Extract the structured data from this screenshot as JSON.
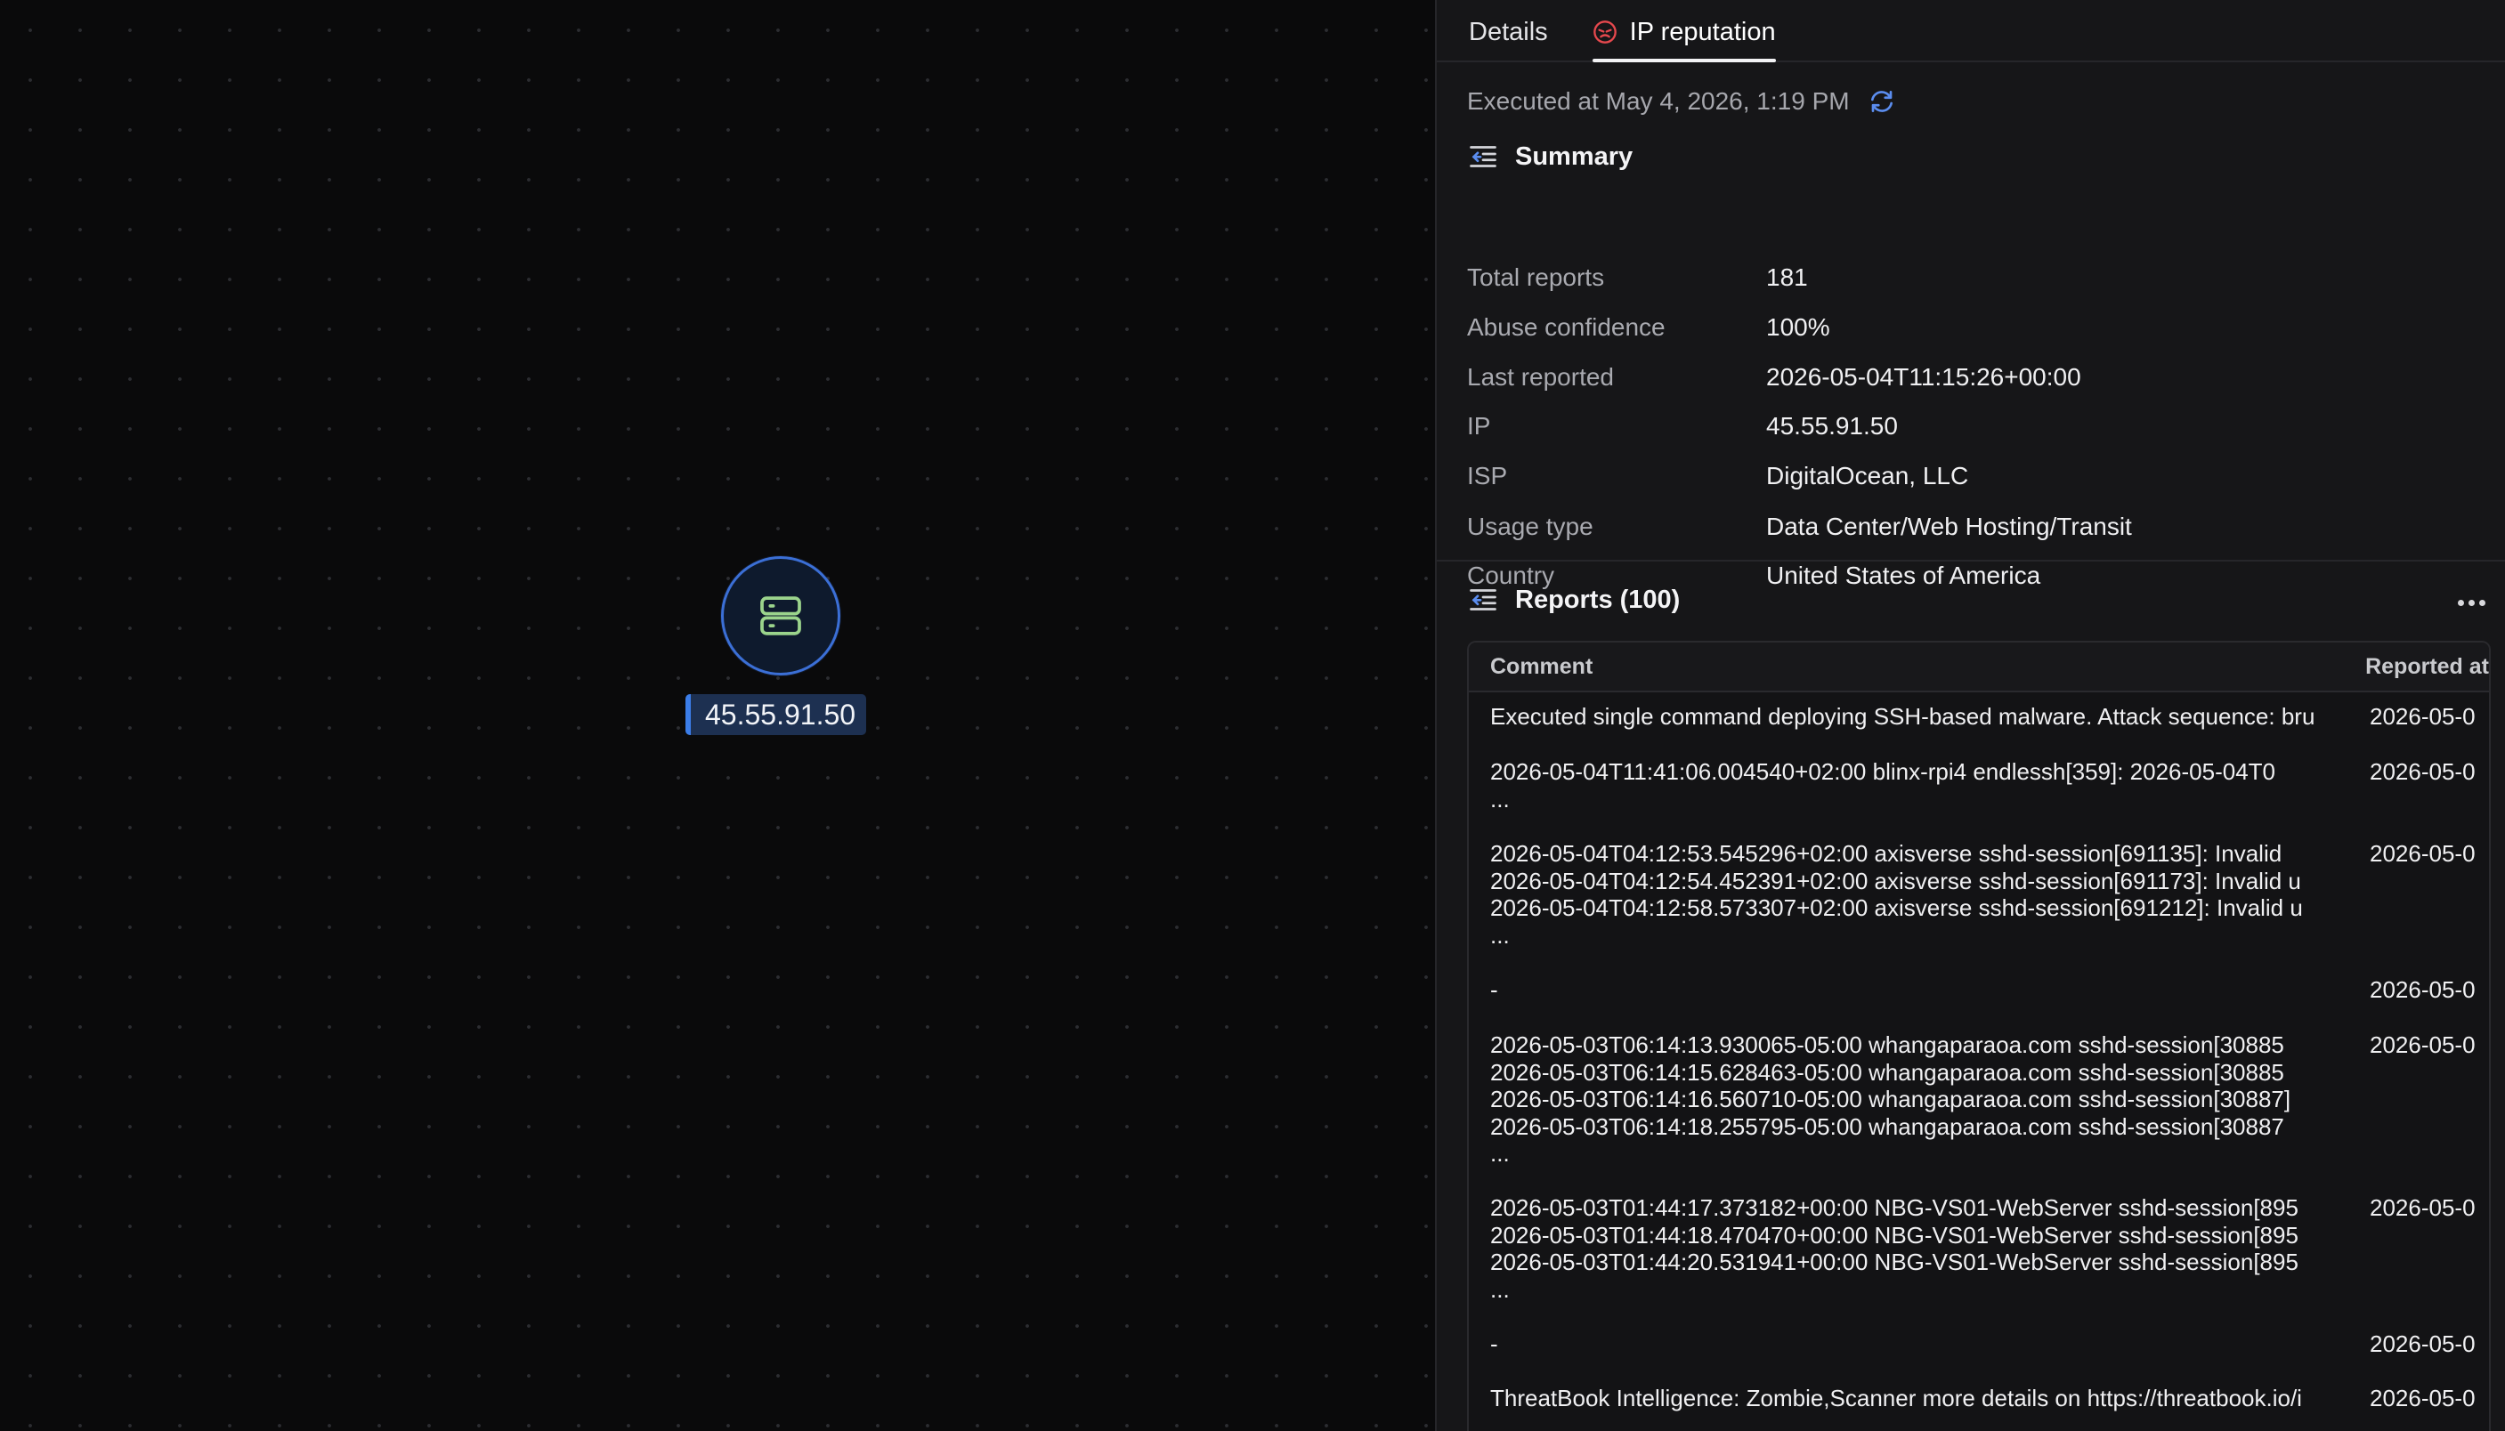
{
  "canvas": {
    "node_label": "45.55.91.50",
    "node_icon": "server-icon",
    "node_color": "#3b6fd6",
    "icon_color": "#9bd48c"
  },
  "panel": {
    "tabs": [
      {
        "label": "Details",
        "active": false
      },
      {
        "label": "IP reputation",
        "active": true,
        "icon": "ip-reputation-icon",
        "icon_color": "#e5484d"
      }
    ],
    "executed": {
      "text": "Executed at May 4, 2026, 1:19 PM",
      "refresh_icon": "refresh-icon",
      "refresh_color": "#5b8def"
    },
    "summary": {
      "title": "Summary",
      "rows": [
        {
          "key": "Total reports",
          "value": "181"
        },
        {
          "key": "Abuse confidence",
          "value": "100%"
        },
        {
          "key": "Last reported",
          "value": "2026-05-04T11:15:26+00:00"
        },
        {
          "key": "IP",
          "value": "45.55.91.50"
        },
        {
          "key": "ISP",
          "value": "DigitalOcean, LLC"
        },
        {
          "key": "Usage type",
          "value": "Data Center/Web Hosting/Transit"
        },
        {
          "key": "Country",
          "value": "United States of America"
        }
      ]
    },
    "reports": {
      "title": "Reports (100)",
      "columns": {
        "comment": "Comment",
        "reported_at": "Reported at"
      },
      "rows": [
        {
          "lines": [
            "Executed single command deploying SSH-based malware. Attack sequence: bru"
          ],
          "reported": "2026-05-0"
        },
        {
          "lines": [
            "2026-05-04T11:41:06.004540+02:00 blinx-rpi4 endlessh[359]: 2026-05-04T0",
            "..."
          ],
          "reported": "2026-05-0"
        },
        {
          "lines": [
            "2026-05-04T04:12:53.545296+02:00 axisverse sshd-session[691135]: Invalid",
            "2026-05-04T04:12:54.452391+02:00 axisverse sshd-session[691173]: Invalid u",
            "2026-05-04T04:12:58.573307+02:00 axisverse sshd-session[691212]: Invalid u",
            "..."
          ],
          "reported": "2026-05-0"
        },
        {
          "lines": [
            "-"
          ],
          "reported": "2026-05-0"
        },
        {
          "lines": [
            "2026-05-03T06:14:13.930065-05:00 whangaparaoa.com sshd-session[30885",
            "2026-05-03T06:14:15.628463-05:00 whangaparaoa.com sshd-session[30885",
            "2026-05-03T06:14:16.560710-05:00 whangaparaoa.com sshd-session[30887]",
            "2026-05-03T06:14:18.255795-05:00 whangaparaoa.com sshd-session[30887",
            "..."
          ],
          "reported": "2026-05-0"
        },
        {
          "lines": [
            "2026-05-03T01:44:17.373182+00:00 NBG-VS01-WebServer sshd-session[895",
            "2026-05-03T01:44:18.470470+00:00 NBG-VS01-WebServer sshd-session[895",
            "2026-05-03T01:44:20.531941+00:00 NBG-VS01-WebServer sshd-session[895",
            "..."
          ],
          "reported": "2026-05-0"
        },
        {
          "lines": [
            "-"
          ],
          "reported": "2026-05-0"
        },
        {
          "lines": [
            "ThreatBook Intelligence: Zombie,Scanner more details on https://threatbook.io/i"
          ],
          "reported": "2026-05-0"
        }
      ]
    }
  }
}
